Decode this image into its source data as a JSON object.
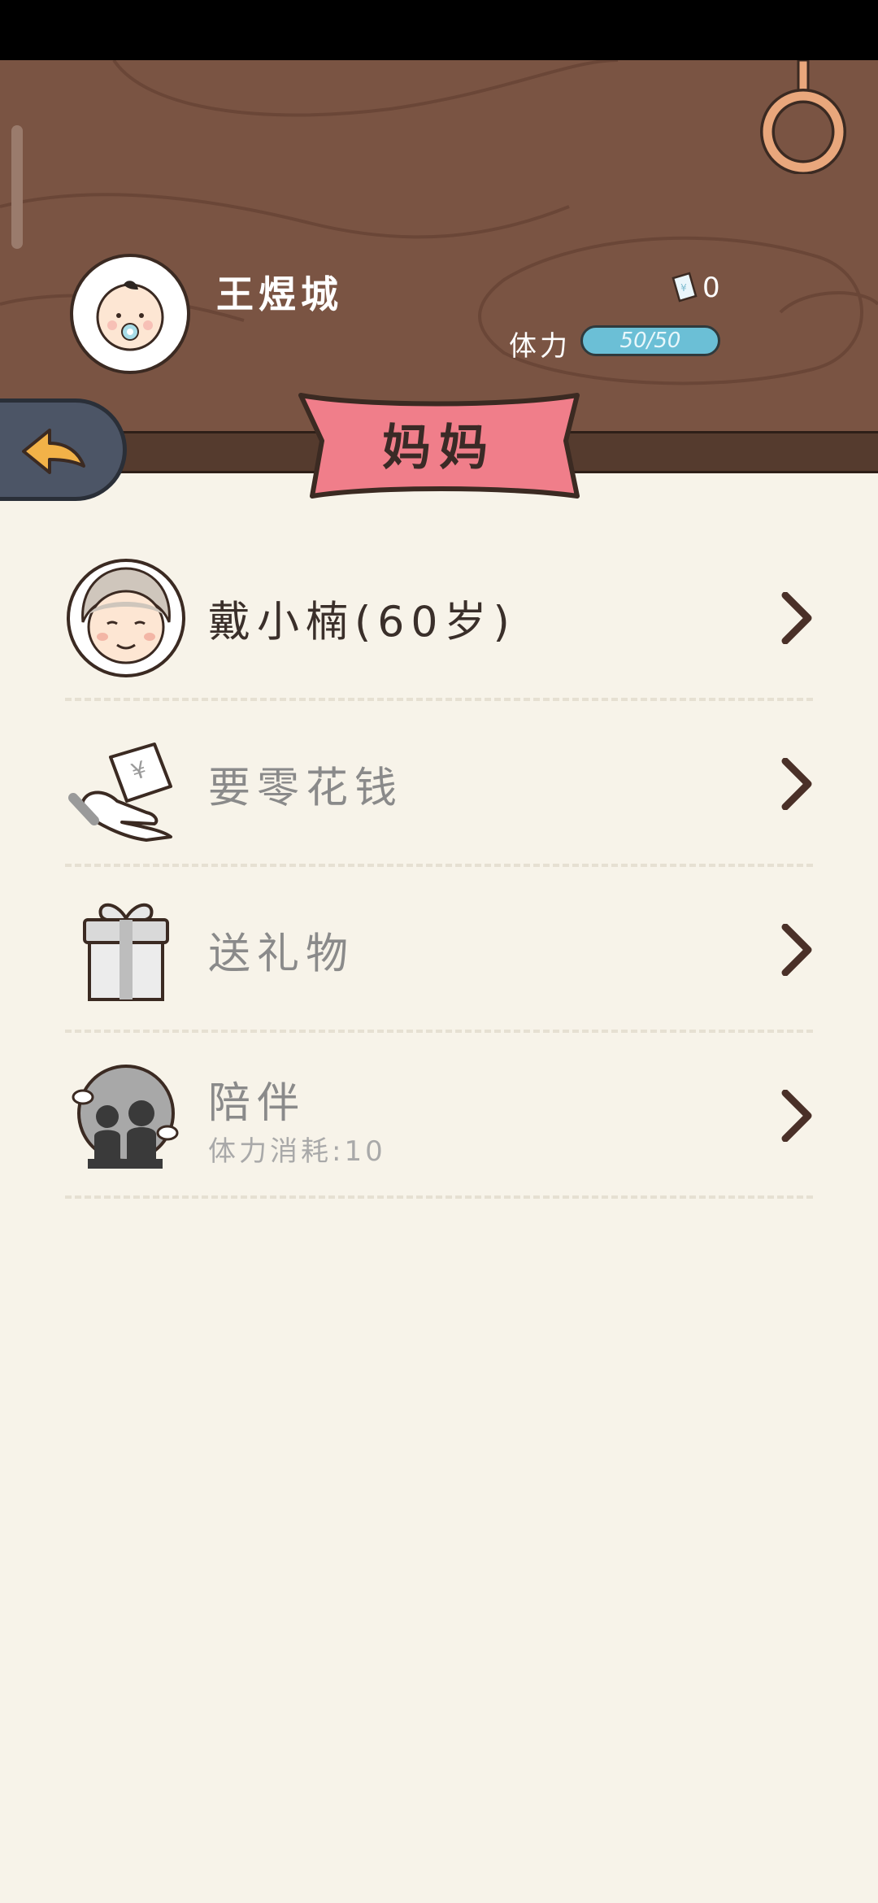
{
  "player": {
    "name": "王煜城",
    "money_value": "0"
  },
  "stamina": {
    "label": "体力",
    "value_text": "50/50",
    "fraction": 1.0
  },
  "page_title": "妈妈",
  "menu": [
    {
      "label": "戴小楠(60岁)",
      "icon": "grandma-avatar-icon"
    },
    {
      "label": "要零花钱",
      "icon": "money-hand-icon"
    },
    {
      "label": "送礼物",
      "icon": "gift-icon"
    },
    {
      "label": "陪伴",
      "sub": "体力消耗:10",
      "icon": "companion-icon"
    }
  ],
  "colors": {
    "header_wood": "#7a5443",
    "ribbon": "#f07e8a",
    "stamina_fill": "#6bbfd6",
    "back_button": "#4c5566",
    "arrow": "#f2b248",
    "background": "#f7f3e9"
  }
}
